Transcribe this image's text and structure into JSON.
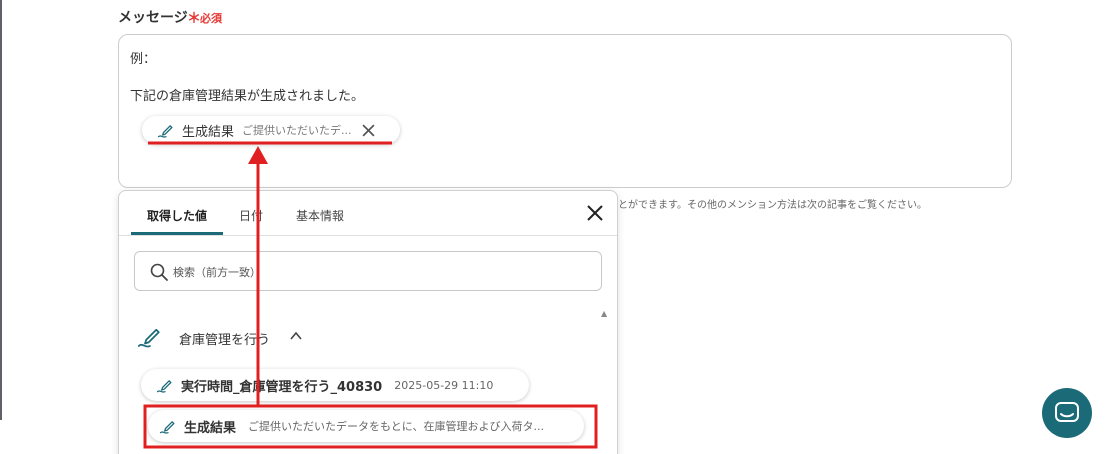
{
  "field": {
    "label": "メッセージ",
    "required_star": "＊",
    "required_text": "必須"
  },
  "message": {
    "line1": "例：",
    "line2": "下記の倉庫管理結果が生成されました。",
    "chip": {
      "icon": "pen-squiggle-icon",
      "title": "生成結果",
      "desc": "ご提供いただいたデ...",
      "close_icon": "close-icon"
    }
  },
  "helper_text": "とができます。その他のメンション方法は次の記事をご覧ください。",
  "dropdown": {
    "tabs": [
      {
        "label": "取得した値",
        "active": true
      },
      {
        "label": "日付",
        "active": false
      },
      {
        "label": "基本情報",
        "active": false
      }
    ],
    "close_icon": "close-icon",
    "search": {
      "icon": "search-icon",
      "placeholder": "検索（前方一致）"
    },
    "scroll_up": "▲",
    "group": {
      "icon": "pen-squiggle-icon",
      "label": "倉庫管理を行う",
      "chevron": "chevron-up-icon"
    },
    "items": [
      {
        "title": "実行時間_倉庫管理を行う_40830",
        "desc": "2025-05-29 11:10"
      },
      {
        "title": "生成結果",
        "desc": "ご提供いただいたデータをもとに、在庫管理および入荷タ..."
      }
    ]
  },
  "colors": {
    "accent": "#1b6a78",
    "annotation_red": "#e02020",
    "required_red": "#e53935"
  },
  "chat_button": {
    "icon": "chat-icon"
  }
}
